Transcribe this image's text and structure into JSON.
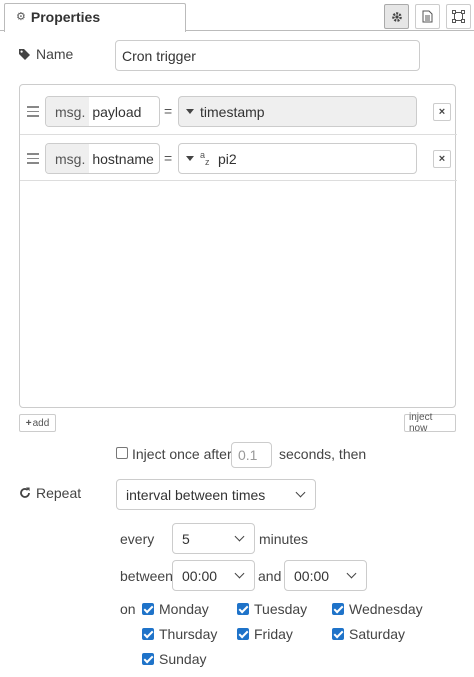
{
  "tabs": {
    "properties_label": "Properties",
    "buttons": [
      "settings",
      "description",
      "appearance"
    ]
  },
  "name": {
    "label": "Name",
    "value": "Cron trigger"
  },
  "props": [
    {
      "prefix": "msg.",
      "key": "payload",
      "eq": "=",
      "type_icon": "caret-down-icon",
      "value": "timestamp",
      "readonly": true,
      "remove": "×"
    },
    {
      "prefix": "msg.",
      "key": "hostname",
      "eq": "=",
      "type_icon": "string-az-icon",
      "value": "pi2",
      "readonly": false,
      "remove": "×"
    }
  ],
  "add_button": "add",
  "inject_now_button": "inject now",
  "inject_once": {
    "label": "Inject once after",
    "value": "0.1",
    "suffix": "seconds, then",
    "checked": false
  },
  "repeat": {
    "label": "Repeat",
    "selected": "interval between times"
  },
  "every": {
    "label": "every",
    "value": "5",
    "unit": "minutes"
  },
  "between": {
    "label": "between",
    "from": "00:00",
    "and_label": "and",
    "to": "00:00"
  },
  "on": {
    "label": "on",
    "days": [
      {
        "name": "Monday",
        "checked": true
      },
      {
        "name": "Tuesday",
        "checked": true
      },
      {
        "name": "Wednesday",
        "checked": true
      },
      {
        "name": "Thursday",
        "checked": true
      },
      {
        "name": "Friday",
        "checked": true
      },
      {
        "name": "Saturday",
        "checked": true
      },
      {
        "name": "Sunday",
        "checked": true
      }
    ]
  },
  "colors": {
    "checkbox": "#1f73c9",
    "readonly_bg": "#efefef",
    "border": "#cccccc"
  }
}
